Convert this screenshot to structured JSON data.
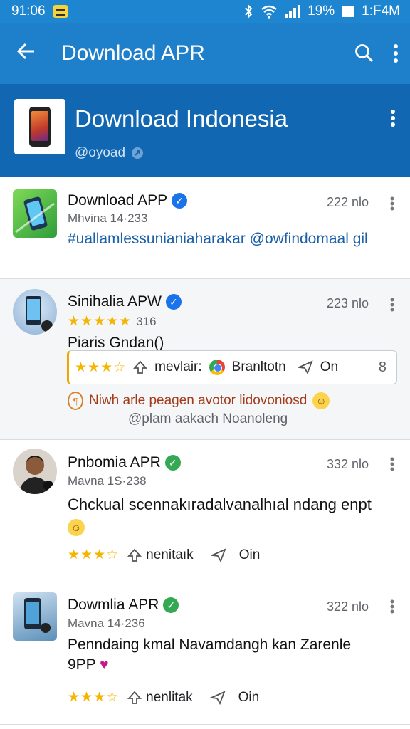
{
  "status_bar": {
    "time": "91:06",
    "battery": "19%",
    "clock_right": "1:F4M"
  },
  "app_bar": {
    "title": "Download APR",
    "icons": [
      "back-arrow-icon",
      "search-icon",
      "more-vert-icon"
    ]
  },
  "channel": {
    "name": "Download Indonesia",
    "handle": "@oyoad"
  },
  "posts": [
    {
      "title": "Download APP",
      "verified": "blue",
      "subtitle": "Mhvina 14·233",
      "meta": "222 nlo",
      "body": "#uallamlessunianiaharakar @owfindomaal gil"
    },
    {
      "title": "Sinihalia APW",
      "verified": "blue",
      "rating": "316",
      "meta": "223 nlo",
      "body": "Piaris Gndan()",
      "inner": {
        "label": "mevlair:",
        "brand": "Branltotn",
        "send": "On",
        "count": "8"
      },
      "promo": "Niwh arle peagen avotor lidovoniosd",
      "promo_sub": "@plam aakach Noanoleng"
    },
    {
      "title": "Pnbomia APR",
      "verified": "green",
      "subtitle": "Mavna 1S·238",
      "meta": "332 nlo",
      "body": "Chckual scennakıradalvanalhıal ndang enpt",
      "action_label": "nenitaık",
      "send": "Oin"
    },
    {
      "title": "Dowmlia APR",
      "verified": "green",
      "subtitle": "Mavna 14·236",
      "meta": "322 nlo",
      "body": "Penndaing kmal Navamdangh kan Zarenle 9PP",
      "action_label": "nenlitak",
      "send": "Oin"
    }
  ],
  "colors": {
    "status_bar": "#1e86d0",
    "app_bar": "#1e7fcb",
    "channel_header": "#1167b1",
    "link_text": "#1a5fa8",
    "star": "#f5b400"
  }
}
